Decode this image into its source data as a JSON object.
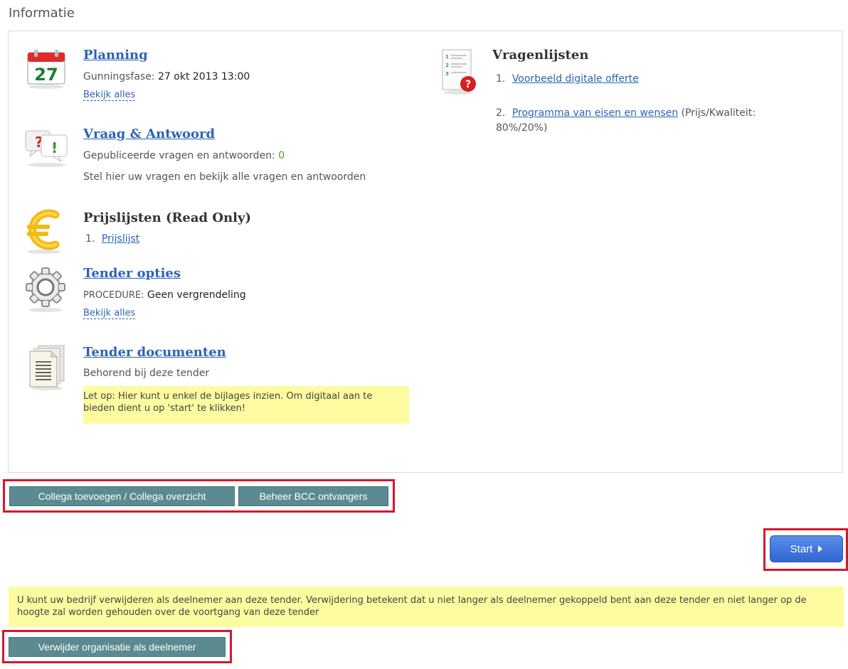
{
  "page": {
    "title": "Informatie"
  },
  "planning": {
    "title": "Planning",
    "calendar_day": "27",
    "phase_label": "Gunningsfase:",
    "phase_value": "27 okt 2013 13:00",
    "view_all": "Bekijk alles"
  },
  "qa": {
    "title": "Vraag & Antwoord",
    "published_label": "Gepubliceerde vragen en antwoorden:",
    "published_count": "0",
    "description": "Stel hier uw vragen en bekijk alle vragen en antwoorden"
  },
  "pricelists": {
    "title": "Prijslijsten (Read Only)",
    "items": [
      {
        "num": "1.",
        "label": "Prijslijst"
      }
    ]
  },
  "tender_options": {
    "title": "Tender opties",
    "procedure_label": "PROCEDURE:",
    "procedure_value": "Geen vergrendeling",
    "view_all": "Bekijk alles"
  },
  "tender_documents": {
    "title": "Tender documenten",
    "subtitle": "Behorend bij deze tender",
    "note": "Let op: Hier kunt u enkel de bijlages inzien. Om digitaal aan te bieden dient u op 'start' te klikken!"
  },
  "questionnaires": {
    "title": "Vragenlijsten",
    "items": [
      {
        "num": "1.",
        "label": "Voorbeeld digitale offerte",
        "suffix": ""
      },
      {
        "num": "2.",
        "label": "Programma van eisen en wensen",
        "suffix": " (Prijs/Kwaliteit: 80%/20%)"
      }
    ]
  },
  "actions": {
    "colleague_button": "Collega toevoegen / Collega overzicht",
    "bcc_button": "Beheer BCC ontvangers",
    "start_button": "Start",
    "remove_note": "U kunt uw bedrijf verwijderen als deelnemer aan deze tender. Verwijdering betekent dat u niet langer als deelnemer gekoppeld bent aan deze tender en niet langer op de hoogte zal worden gehouden over de voortgang van deze tender",
    "remove_button": "Verwijder organisatie als deelnemer"
  },
  "icons": {
    "planning": "calendar-icon",
    "qa": "question-answer-icon",
    "pricelists": "euro-icon",
    "tender_options": "gear-icon",
    "tender_documents": "document-icon",
    "questionnaires": "checklist-icon"
  },
  "colors": {
    "link": "#2d63b5",
    "note_background": "#fdfb9f",
    "button_teal": "#5b8a90",
    "start_blue": "#2f66d2",
    "highlight_frame": "#d4182b"
  }
}
